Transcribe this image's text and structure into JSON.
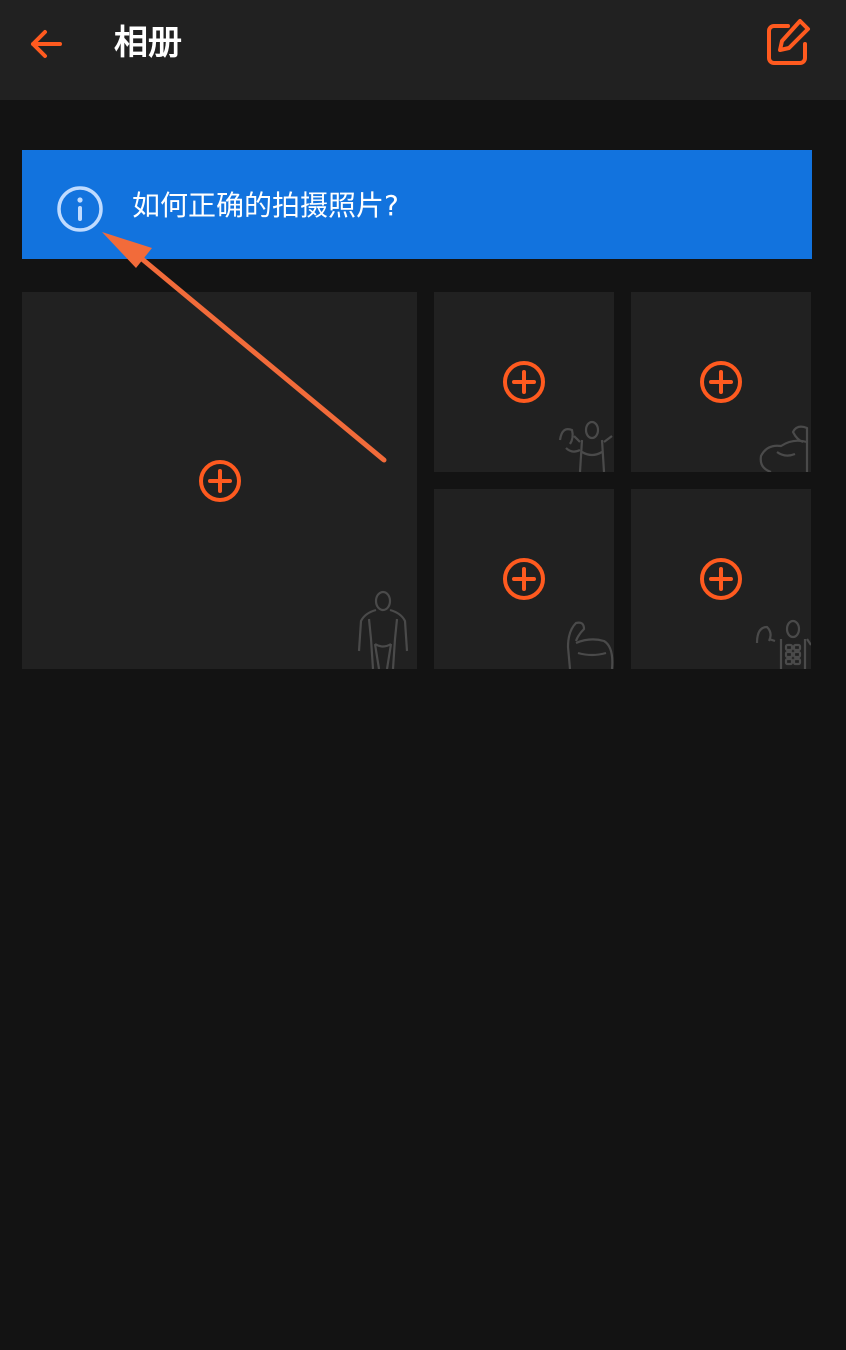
{
  "header": {
    "title": "相册",
    "back_icon": "arrow-left-icon",
    "edit_icon": "edit-icon"
  },
  "info_banner": {
    "icon": "info-icon",
    "text": "如何正确的拍摄照片?"
  },
  "photo_slots": [
    {
      "label": "front-full-body",
      "icon": "plus-circle-icon"
    },
    {
      "label": "back-double-biceps",
      "icon": "plus-circle-icon"
    },
    {
      "label": "right-arm-flex",
      "icon": "plus-circle-icon"
    },
    {
      "label": "left-arm-flex",
      "icon": "plus-circle-icon"
    },
    {
      "label": "front-abs-pose",
      "icon": "plus-circle-icon"
    }
  ],
  "colors": {
    "background": "#131313",
    "header_bg": "#212121",
    "tile_bg": "#212121",
    "accent": "#FF5A1F",
    "banner_bg": "#1273DE",
    "silhouette": "#4A4A4A",
    "annotation_arrow": "#F26B3A"
  }
}
